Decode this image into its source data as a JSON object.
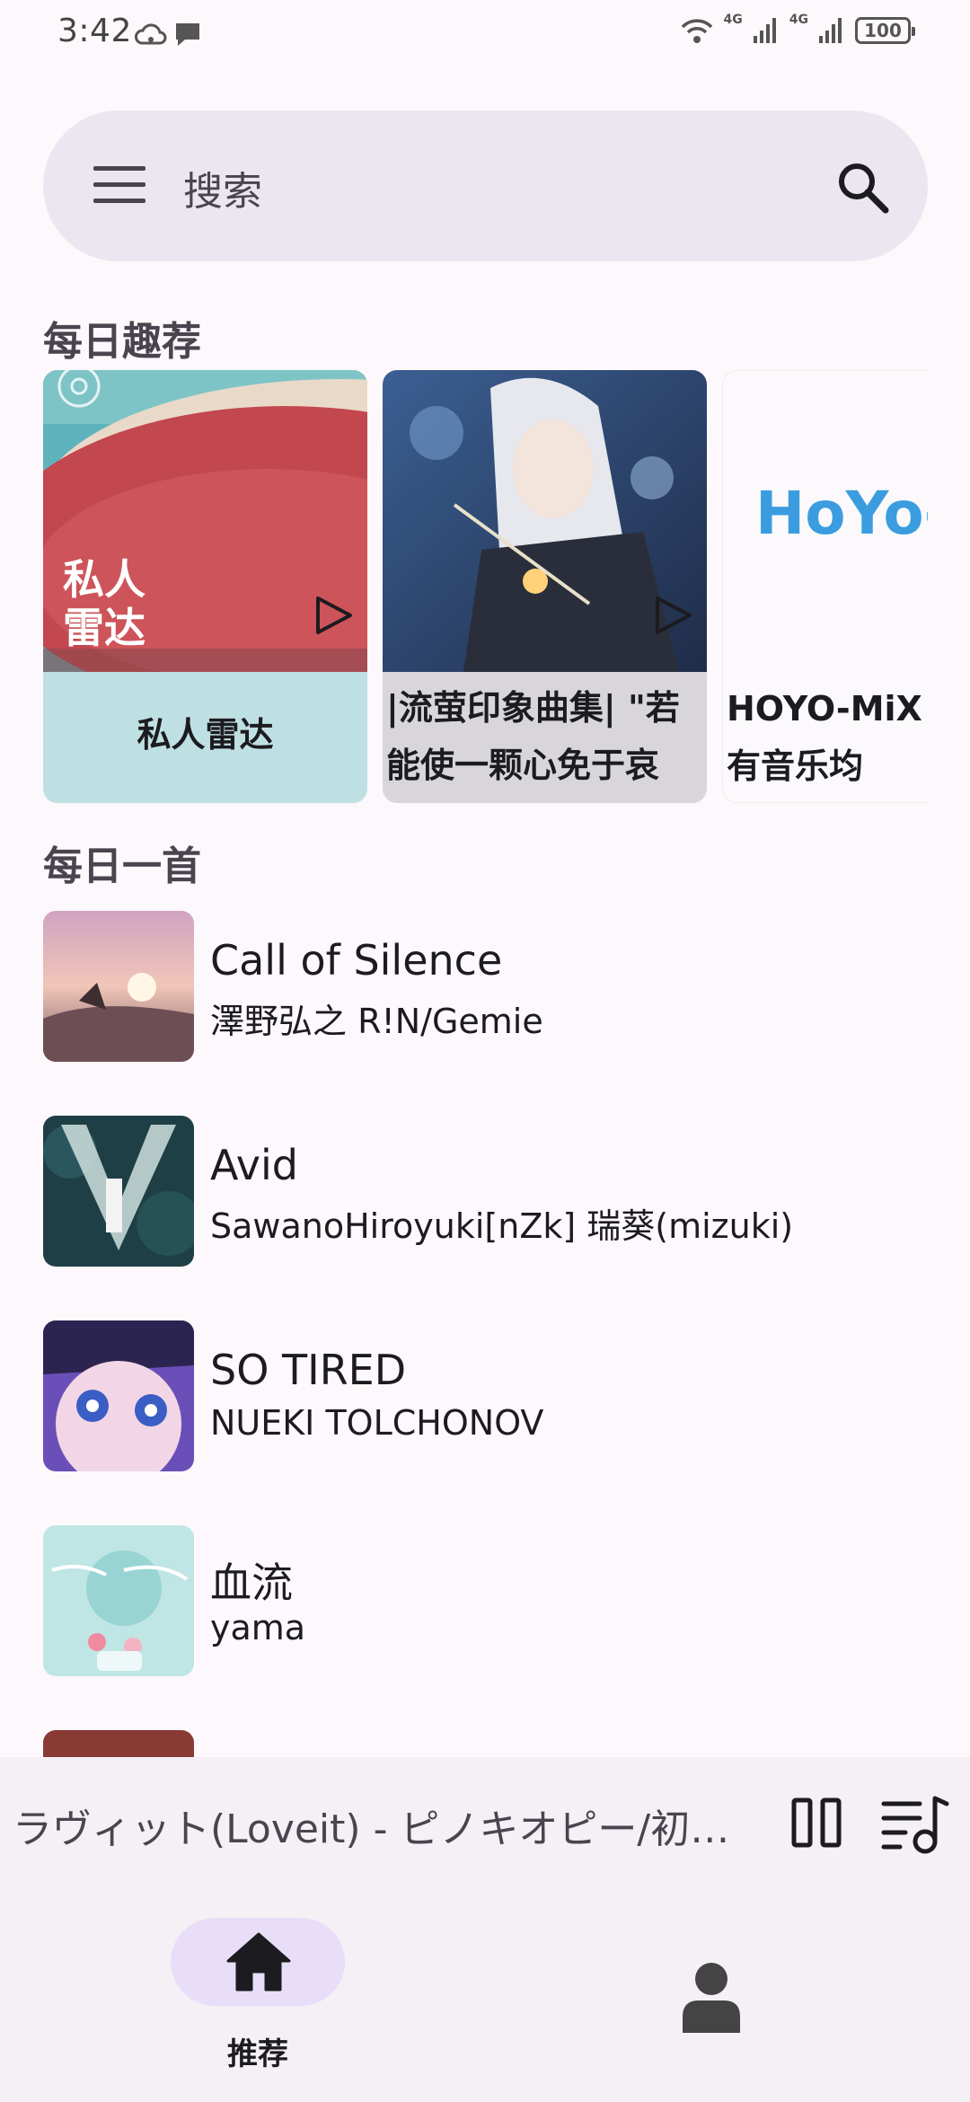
{
  "status_bar": {
    "time": "3:42",
    "network_1": "4G",
    "network_2": "4G",
    "battery": "100"
  },
  "search": {
    "placeholder": "搜索",
    "menu_icon": "menu-icon",
    "search_icon": "search-icon"
  },
  "daily_picks": {
    "title": "每日趣荐",
    "cards": [
      {
        "overlay_text": "私人\n雷达",
        "label": "私人雷达"
      },
      {
        "label": "|流萤印象曲集| \"若能使一颗心免于哀"
      },
      {
        "logo_text": "HoYo-M",
        "label": "HOYO-MiX (所有音乐均"
      }
    ]
  },
  "daily_song": {
    "title": "每日一首",
    "songs": [
      {
        "title": "Call of Silence",
        "artist": "澤野弘之 R!N/Gemie"
      },
      {
        "title": "Avid",
        "artist": "SawanoHiroyuki[nZk] 瑞葵(mizuki)"
      },
      {
        "title": "SO TIRED",
        "artist": "NUEKI TOLCHONOV"
      },
      {
        "title": "血流",
        "artist": "yama"
      }
    ]
  },
  "mini_player": {
    "now_playing": "ラヴィット(Loveit) - ピノキオピー/初音ミク"
  },
  "bottom_nav": {
    "home_label": "推荐"
  },
  "colors": {
    "background": "#fdf8fc",
    "search_bg": "#ece6f0",
    "nav_active": "#e8def8",
    "card1_label_bg": "#bfe0e3",
    "card2_label_bg": "#d8d6db"
  }
}
